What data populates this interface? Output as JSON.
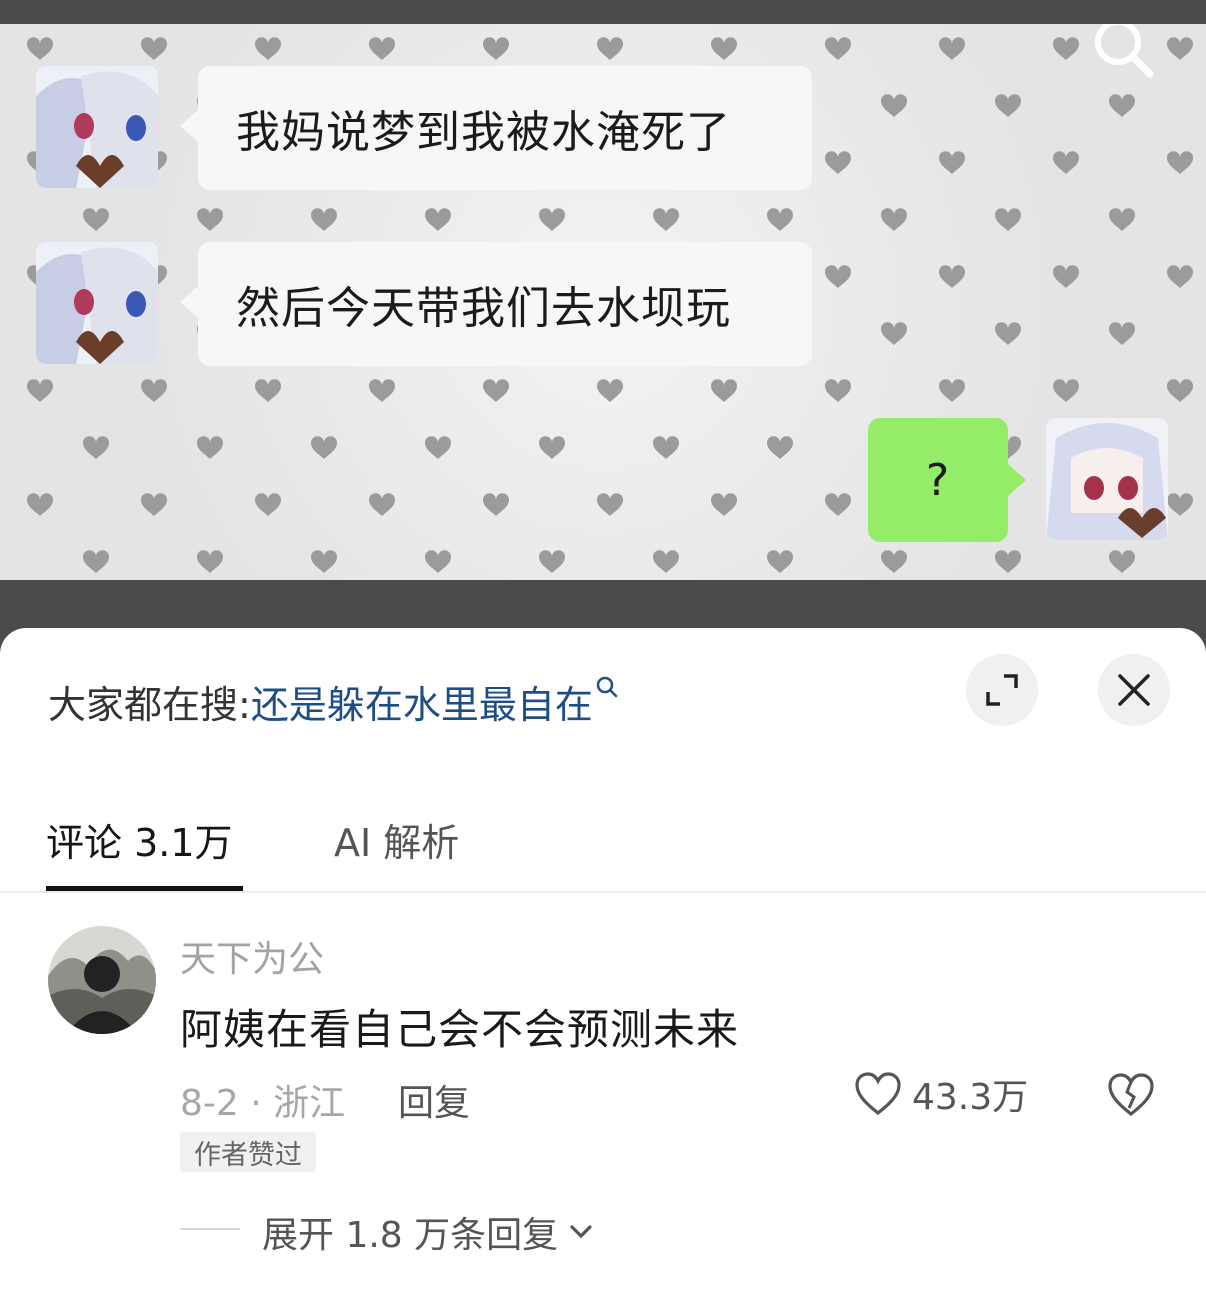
{
  "chat": {
    "messages": [
      {
        "side": "left",
        "text": "我妈说梦到我被水淹死了"
      },
      {
        "side": "left",
        "text": "然后今天带我们去水坝玩"
      },
      {
        "side": "right",
        "text": "?"
      }
    ]
  },
  "sheet": {
    "hot_search_label": "大家都在搜:",
    "hot_search_query": "还是躲在水里最自在",
    "tabs": [
      {
        "label": "评论 3.1万",
        "active": true
      },
      {
        "label": "AI 解析",
        "active": false
      }
    ]
  },
  "comment": {
    "user": "天下为公",
    "text": "阿姨在看自己会不会预测未来",
    "meta": "8-2 · 浙江",
    "reply_label": "回复",
    "likes": "43.3万",
    "badge": "作者赞过",
    "expand_label": "展开 1.8 万条回复"
  },
  "colors": {
    "link": "#1f4d86",
    "bubble_right": "#95ec69",
    "bubble_left": "#f7f7f7"
  }
}
